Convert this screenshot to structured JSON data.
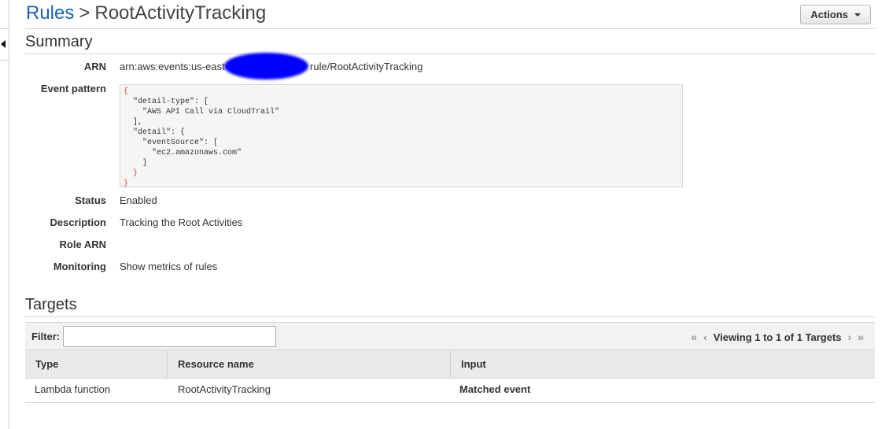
{
  "breadcrumb": {
    "parent": "Rules",
    "separator": ">",
    "current": "RootActivityTracking"
  },
  "actions": {
    "label": "Actions"
  },
  "summary": {
    "title": "Summary",
    "arn": {
      "label": "ARN",
      "value_prefix": "arn:aws:events:us-east-",
      "value_suffix": "rule/RootActivityTracking"
    },
    "event_pattern": {
      "label": "Event pattern",
      "lines": [
        "{",
        "  \"detail-type\": [",
        "    \"AWS API Call via CloudTrail\"",
        "  ],",
        "  \"detail\": {",
        "    \"eventSource\": [",
        "      \"ec2.amazonaws.com\"",
        "    ]",
        "  }",
        "}"
      ]
    },
    "status": {
      "label": "Status",
      "value": "Enabled"
    },
    "description": {
      "label": "Description",
      "value": "Tracking the Root Activities"
    },
    "role_arn": {
      "label": "Role ARN",
      "value": ""
    },
    "monitoring": {
      "label": "Monitoring",
      "link": "Show metrics of rules"
    }
  },
  "targets": {
    "title": "Targets",
    "filter": {
      "label": "Filter:",
      "value": ""
    },
    "pagination": {
      "text": "Viewing 1 to 1 of 1 Targets"
    },
    "columns": [
      "Type",
      "Resource name",
      "Input"
    ],
    "rows": [
      {
        "type": "Lambda function",
        "resource_name": "RootActivityTracking",
        "input": "Matched event"
      }
    ]
  },
  "colors": {
    "link": "#1a63b5",
    "enabled": "#1d8102",
    "redaction": "#0000ff"
  }
}
